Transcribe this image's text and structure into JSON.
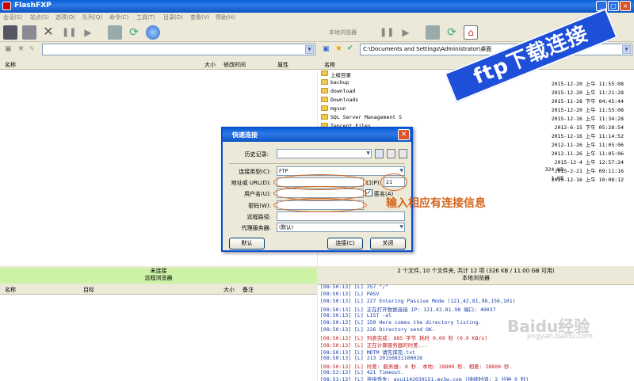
{
  "window": {
    "title": "FlashFXP",
    "minimize": "_",
    "maximize": "□",
    "close": "×"
  },
  "menu": [
    "会话(S)",
    "站点(S)",
    "选项(O)",
    "队列(Q)",
    "命令(C)",
    "工具(T)",
    "目录(D)",
    "查看(V)",
    "帮助(H)"
  ],
  "right_toolbar": {
    "label": "本地浏览器"
  },
  "right_path": {
    "value": "C:\\Documents and Settings\\Administrator\\桌面"
  },
  "left_header": {
    "name": "名称",
    "size": "大小",
    "modified": "修改时间",
    "attributes": "属性"
  },
  "right_header": {
    "name": "名称"
  },
  "right_files": [
    {
      "name": "上级目录",
      "size": "",
      "date": ""
    },
    {
      "name": "backup",
      "size": "",
      "date": "2015-12-20 上午 11:55:08"
    },
    {
      "name": "download",
      "size": "",
      "date": "2015-12-20 上午 11:21:28"
    },
    {
      "name": "Downloads",
      "size": "",
      "date": "2015-11-28 下午 04:45:44"
    },
    {
      "name": "mgvun",
      "size": "",
      "date": "2015-12-20 上午 11:55:08"
    },
    {
      "name": "SQL Server Management S",
      "size": "",
      "date": "2015-12-16 上午 11:34:28"
    },
    {
      "name": "Tencent Files",
      "size": "",
      "date": "2012-6-15 下午 05:28:54"
    },
    {
      "name": "",
      "size": "",
      "date": "2015-12-16 上午 11:14:52"
    },
    {
      "name": "",
      "size": "",
      "date": "2012-11-26 上午 11:05:06"
    },
    {
      "name": "",
      "size": "",
      "date": "2012-11-26 上午 11:05:06"
    },
    {
      "name": "",
      "size": "",
      "date": "2015-12-4 上午 12:57:24"
    },
    {
      "name": "",
      "size": "324 KB",
      "date": "2015-2-21 上午 09:11:16"
    },
    {
      "name": "",
      "size": "1 KB",
      "date": "2015-12-16 上午 10:08:12"
    }
  ],
  "left_status": {
    "line1": "未连接",
    "line2": "远程浏览器"
  },
  "right_status": {
    "line1": "2 个文件, 10 个文件夹, 共计 12 项 (326 KB / 11.00 GB 可用)",
    "line2": "本地浏览器"
  },
  "queue_header": {
    "name": "名称",
    "target": "目标",
    "size": "大小",
    "note": "备注"
  },
  "log": [
    {
      "text": "[08:50:13] [L] 257 \"/\"",
      "color": "#1a3fa8"
    },
    {
      "text": "[08:50:13] [L] PASV",
      "color": "#1a3fa8"
    },
    {
      "text": "[08:50:13] [L] 227 Entering Passive Mode (121,42,81,98,156,101)",
      "color": "#1a3fa8"
    },
    {
      "text": "[08:50:13] [L] 正在打开数据连接 IP: 121.42.81.98 端口: 40037",
      "color": "#1a3fa8"
    },
    {
      "text": "[08:50:13] [L] LIST -al",
      "color": "#1a3fa8"
    },
    {
      "text": "[08:50:13] [L] 150 Here comes the directory listing.",
      "color": "#1a3fa8"
    },
    {
      "text": "[08:50:13] [L] 226 Directory send OK.",
      "color": "#1a3fa8"
    },
    {
      "text": "[08:50:13] [L] 列表完成: 885 字节 耗时 0.09 秒 (0.9 KB/s)",
      "color": "#c21d1d"
    },
    {
      "text": "[08:50:13] [L] 正在计算服务器的时差...",
      "color": "#c21d1d"
    },
    {
      "text": "[08:50:13] [L] MDTM 请先译完.txt",
      "color": "#1a3fa8"
    },
    {
      "text": "[08:50:13] [L] 213 20150831100026",
      "color": "#1a3fa8"
    },
    {
      "text": "[08:50:13] [L] 时差: 服务器: 0 秒. 本地: 28800 秒. 相差: 28800 秒.",
      "color": "#c21d1d"
    },
    {
      "text": "[08:53:13] [L] 421 Timeout.",
      "color": "#1a3fa8"
    },
    {
      "text": "[08:53:13] [L] 连接丢失: qxu1142030151.my3w.com (持续时间: 3 分钟 0 秒)",
      "color": "#1a3fa8"
    }
  ],
  "dialog": {
    "title": "快速连接",
    "history_label": "历史记录:",
    "conn_type_label": "连接类型(C):",
    "conn_type_value": "FTP",
    "address_label": "地址或 URL(D):",
    "port_label": "口(P):",
    "port_value": "21",
    "username_label": "用户名(U):",
    "anonymous_label": "匿名(A)",
    "password_label": "密码(W):",
    "remote_path_label": "远程路径:",
    "proxy_label": "代理服务器:",
    "proxy_value": "(默认)",
    "default_button": "默认",
    "connect_button": "连接(C)",
    "close_button": "关闭"
  },
  "annotations": {
    "banner": "ftp下载连接",
    "hint": "输入相应有连接信息",
    "watermark": "Baidu经验",
    "watermark_url": "jingyan.baidu.com"
  }
}
